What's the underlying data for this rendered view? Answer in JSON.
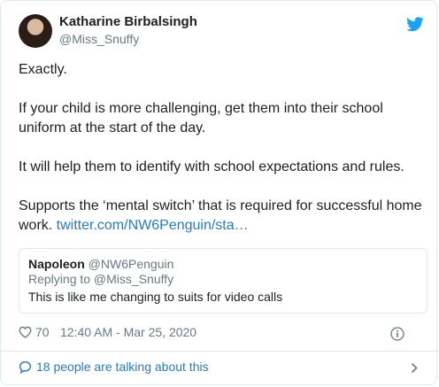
{
  "author": {
    "name": "Katharine Birbalsingh",
    "handle": "@Miss_Snuffy"
  },
  "tweet": {
    "lines": [
      "Exactly.",
      "If your child is more challenging, get them into their school uniform at the start of the day.",
      "It will help them to identify with school expectations and rules.",
      "Supports the ‘mental switch’ that is required for successful home work. "
    ],
    "link": "twitter.com/NW6Penguin/sta…"
  },
  "quoted_tweet": {
    "name": "Napoleon",
    "handle": "@NW6Penguin",
    "replying_to": "Replying to @Miss_Snuffy",
    "text": "This is like me changing to suits for video calls"
  },
  "footer": {
    "likes": "70",
    "timestamp": "12:40 AM - Mar 25, 2020"
  },
  "conversation": {
    "label": "18 people are talking about this"
  },
  "icons": {
    "brand": "twitter-bird-icon",
    "like": "heart-icon",
    "info": "info-icon",
    "reply": "chat-bubble-icon",
    "chevron": "chevron-right-icon"
  },
  "colors": {
    "link": "#2b7bb9",
    "brand": "#1da1f2",
    "muted": "#697882",
    "text": "#1c2022",
    "border": "#e1e8ed"
  }
}
